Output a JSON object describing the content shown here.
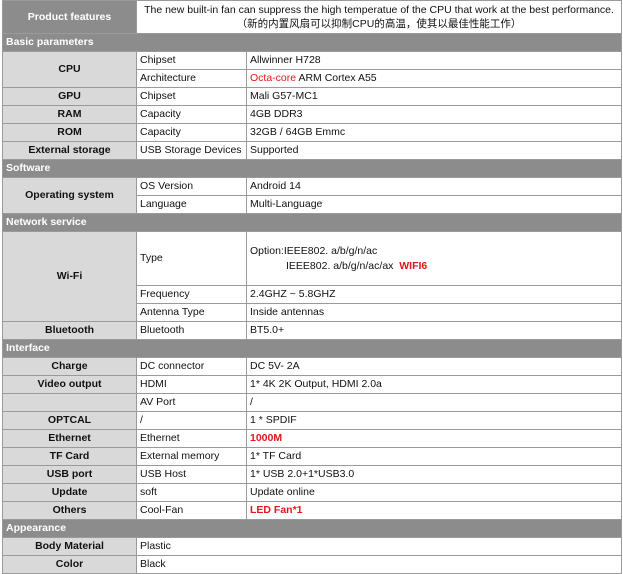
{
  "product_features": {
    "label": "Product features",
    "text_en": "The new built-in fan can suppress the high temperatue of the CPU that work at the best performance.",
    "text_cn": "（新的内置风扇可以抑制CPU的高温，使其以最佳性能工作）"
  },
  "sections": {
    "basic": "Basic parameters",
    "software": "Software",
    "network": "Network service",
    "interface": "Interface",
    "appearance": "Appearance"
  },
  "cpu": {
    "label": "CPU",
    "chipset_k": "Chipset",
    "chipset_v": "Allwinner  H728",
    "arch_k": "Architecture",
    "arch_hl": "Octa-core",
    "arch_rest": " ARM Cortex A55"
  },
  "gpu": {
    "label": "GPU",
    "k": "Chipset",
    "v": "Mali G57-MC1"
  },
  "ram": {
    "label": "RAM",
    "k": "Capacity",
    "v": "4GB DDR3"
  },
  "rom": {
    "label": "ROM",
    "k": "Capacity",
    "v": "32GB / 64GB Emmc"
  },
  "ext_storage": {
    "label": "External storage",
    "k": "USB Storage Devices",
    "v": "Supported"
  },
  "os": {
    "label": "Operating system",
    "ver_k": "OS Version",
    "ver_v": "Android 14",
    "lang_k": "Language",
    "lang_v": "Multi-Language"
  },
  "wifi": {
    "label": "Wi-Fi",
    "type_k": "Type",
    "type_line1": "Option:IEEE802. a/b/g/n/ac",
    "type_line2": "IEEE802. a/b/g/n/ac/ax",
    "type_hl": "WIFI6",
    "freq_k": "Frequency",
    "freq_v": "2.4GHZ ~ 5.8GHZ",
    "ant_k": "Antenna Type",
    "ant_v": "Inside antennas"
  },
  "bluetooth": {
    "label": "Bluetooth",
    "k": "Bluetooth",
    "v": "BT5.0+"
  },
  "charge": {
    "label": "Charge",
    "k": "DC connector",
    "v": "DC 5V- 2A"
  },
  "video": {
    "label": "Video output",
    "hdmi_k": "HDMI",
    "hdmi_v": "1* 4K 2K Output, HDMI 2.0a",
    "av_k": "AV Port",
    "av_v": "/"
  },
  "optcal": {
    "label": "OPTCAL",
    "k": "/",
    "v": "1 * SPDIF"
  },
  "ethernet": {
    "label": "Ethernet",
    "k": "Ethernet",
    "v": "1000M"
  },
  "tfcard": {
    "label": "TF Card",
    "k": "External memory",
    "v": "1* TF Card"
  },
  "usb": {
    "label": "USB port",
    "k": "USB Host",
    "v": "1* USB 2.0+1*USB3.0"
  },
  "update": {
    "label": "Update",
    "k": "soft",
    "v": "Update online"
  },
  "others": {
    "label": "Others",
    "k": "Cool-Fan",
    "v": "LED Fan*1"
  },
  "body_material": {
    "label": "Body Material",
    "v": "Plastic"
  },
  "color": {
    "label": "Color",
    "v": "Black"
  }
}
